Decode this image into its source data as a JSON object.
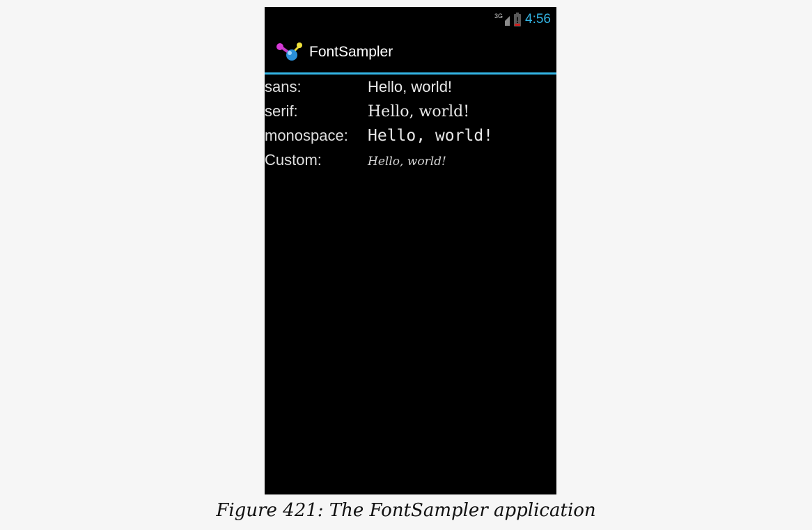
{
  "status_bar": {
    "network_type": "3G",
    "time": "4:56",
    "battery_level_fraction": 0.15,
    "battery_alert_glyph": "!",
    "icons": [
      "signal-icon",
      "battery-icon"
    ]
  },
  "action_bar": {
    "title": "FontSampler",
    "icon": "app-molecule-icon"
  },
  "font_rows": [
    {
      "label": "sans:",
      "sample": "Hello, world!"
    },
    {
      "label": "serif:",
      "sample": "Hello, world!"
    },
    {
      "label": "monospace:",
      "sample": "Hello, world!"
    },
    {
      "label": "Custom:",
      "sample": "Hello, world!"
    }
  ],
  "caption": "Figure 421: The FontSampler application",
  "colors": {
    "accent": "#33b5e5",
    "screen_background": "#000000",
    "page_background": "#f6f6f6"
  }
}
